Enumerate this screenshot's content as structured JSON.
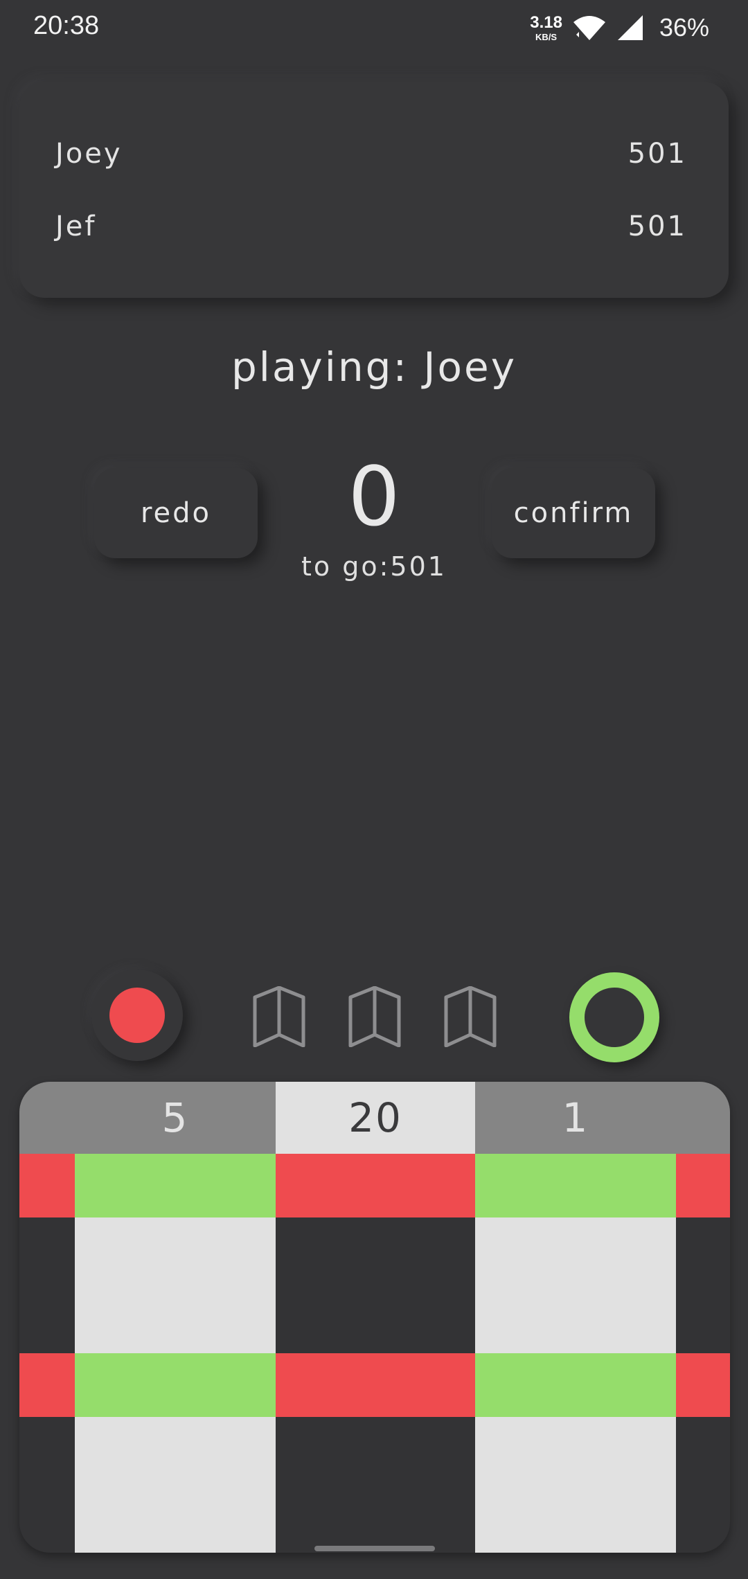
{
  "status_bar": {
    "time": "20:38",
    "net_speed": "3.18",
    "net_unit": "KB/S",
    "battery": "36%"
  },
  "players": [
    {
      "name": "Joey",
      "score": "501"
    },
    {
      "name": "Jef",
      "score": "501"
    }
  ],
  "game": {
    "playing_label": "playing: Joey",
    "current_score": "0",
    "to_go": "to go:501",
    "redo_label": "redo",
    "confirm_label": "confirm"
  },
  "darts": {
    "remaining": 3,
    "icons": [
      "dart-icon",
      "dart-icon",
      "dart-icon"
    ]
  },
  "board": {
    "segments": [
      "5",
      "20",
      "1"
    ],
    "colors": {
      "red": "#ef4b4f",
      "green": "#95dd6b",
      "light": "#e1e1e1",
      "dark": "#333335",
      "header_gray": "#858585"
    }
  }
}
